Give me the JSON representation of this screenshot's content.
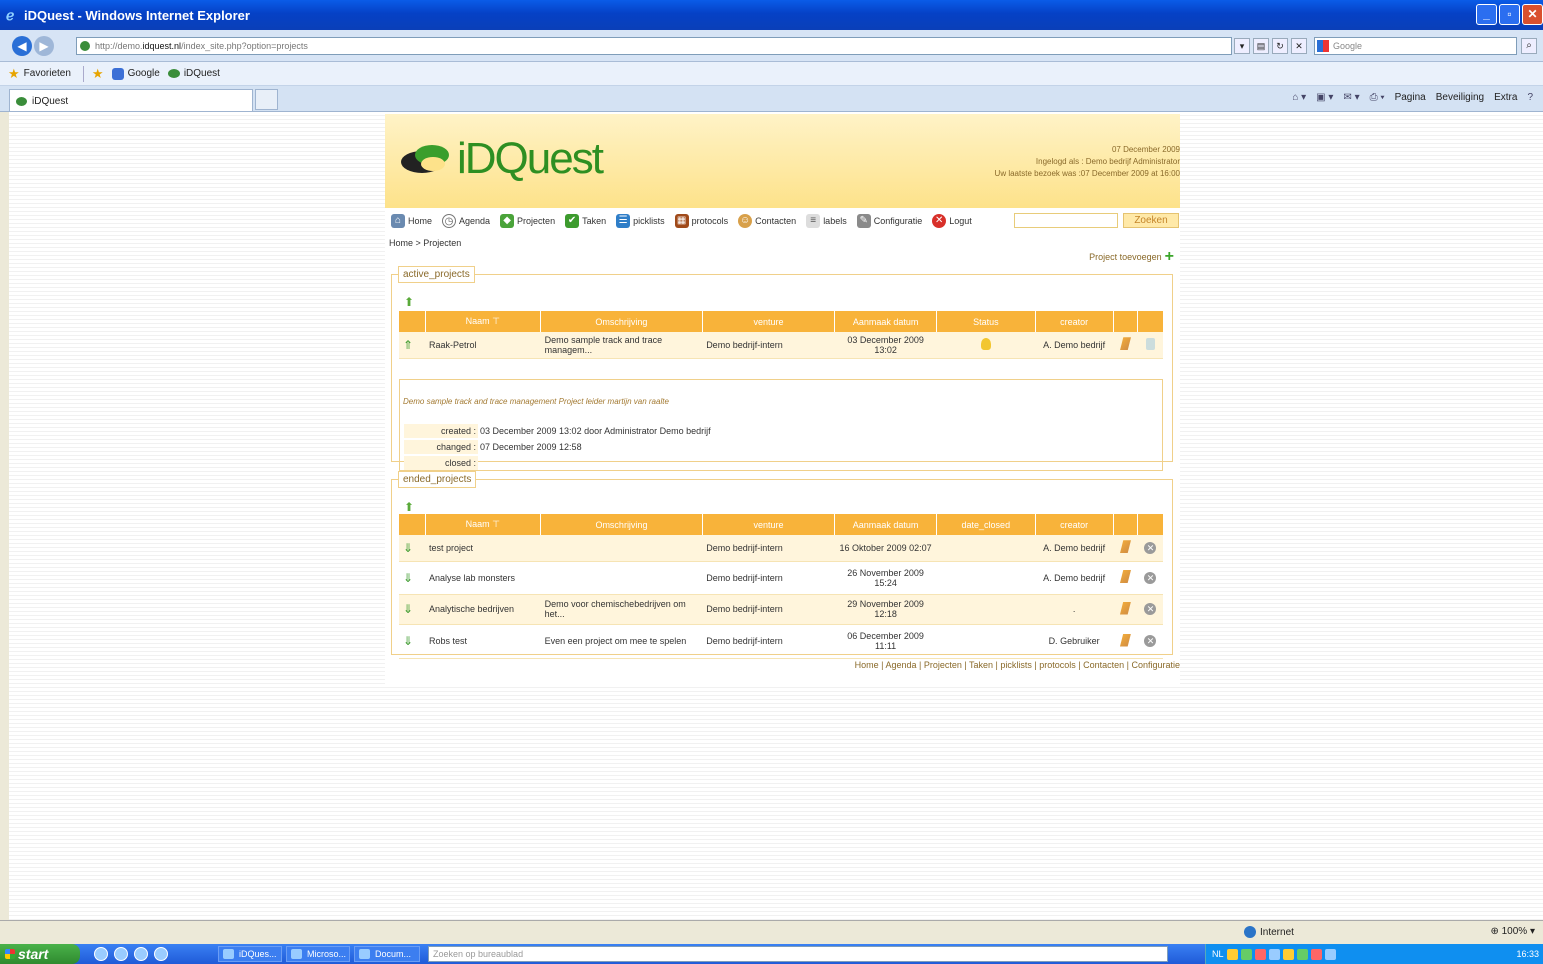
{
  "browser": {
    "title": "iDQuest - Windows Internet Explorer",
    "url_prefix": "http://demo.",
    "url_domain": "idquest.nl",
    "url_path": "/index_site.php?option=projects",
    "search_placeholder": "Google",
    "favorites_label": "Favorieten",
    "fav_links": [
      "Google",
      "iDQuest"
    ],
    "tab_title": "iDQuest",
    "commands": [
      "Pagina",
      "Beveiliging",
      "Extra"
    ]
  },
  "header": {
    "logo_text": "iDQuest",
    "date": "07 December 2009",
    "logged_in": "Ingelogd als : Demo bedrijf Administrator",
    "last_visit": "Uw laatste bezoek was :07 December 2009 at 16:00"
  },
  "nav": {
    "items": [
      "Home",
      "Agenda",
      "Projecten",
      "Taken",
      "picklists",
      "protocols",
      "Contacten",
      "labels",
      "Configuratie",
      "Logut"
    ],
    "search_button": "Zoeken"
  },
  "breadcrumb": "Home > Projecten",
  "add_project": "Project toevoegen",
  "active": {
    "legend": "active_projects",
    "headers": [
      "Naam",
      "Omschrijving",
      "venture",
      "Aanmaak datum",
      "Status",
      "creator"
    ],
    "sort_mark": "⊤",
    "rows": [
      {
        "name": "Raak-Petrol",
        "desc": "Demo sample track and trace managem...",
        "venture": "Demo bedrijf-intern",
        "date": "03 December 2009 13:02",
        "creator": "A. Demo bedrijf"
      }
    ],
    "detail": {
      "desc": "Demo sample track and trace management Project leider martijn van raalte",
      "created_label": "created :",
      "created_value": "03 December 2009 13:02 door Administrator Demo bedrijf",
      "changed_label": "changed :",
      "changed_value": "07 December 2009 12:58",
      "closed_label": "closed :"
    }
  },
  "ended": {
    "legend": "ended_projects",
    "headers": [
      "Naam",
      "Omschrijving",
      "venture",
      "Aanmaak datum",
      "date_closed",
      "creator"
    ],
    "rows": [
      {
        "name": "test project",
        "desc": "",
        "venture": "Demo bedrijf-intern",
        "date": "16 Oktober 2009 02:07",
        "closed": "",
        "creator": "A. Demo bedrijf"
      },
      {
        "name": "Analyse lab monsters",
        "desc": "",
        "venture": "Demo bedrijf-intern",
        "date": "26 November 2009 15:24",
        "closed": "",
        "creator": "A. Demo bedrijf"
      },
      {
        "name": "Analytische bedrijven",
        "desc": "Demo voor chemischebedrijven om het...",
        "venture": "Demo bedrijf-intern",
        "date": "29 November 2009 12:18",
        "closed": "",
        "creator": "."
      },
      {
        "name": "Robs test",
        "desc": "Even een project om mee te spelen",
        "venture": "Demo bedrijf-intern",
        "date": "06 December 2009 11:11",
        "closed": "",
        "creator": "D. Gebruiker"
      }
    ]
  },
  "footer_nav": "Home | Agenda | Projecten | Taken | picklists | protocols | Contacten | Configuratie",
  "status": {
    "zone": "Internet",
    "zoom": "100%"
  },
  "taskbar": {
    "start": "start",
    "tasks": [
      "iDQues...",
      "Microso...",
      "Docum..."
    ],
    "search_placeholder": "Zoeken op bureaublad",
    "lang": "NL",
    "clock": "16:33"
  }
}
